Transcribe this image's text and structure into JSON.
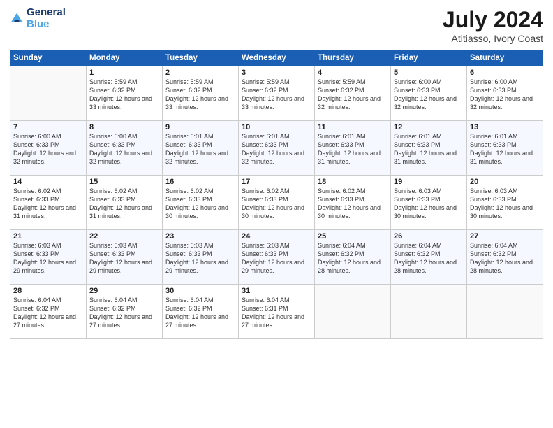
{
  "logo": {
    "line1": "General",
    "line2": "Blue"
  },
  "title": "July 2024",
  "location": "Atitiasso, Ivory Coast",
  "days_of_week": [
    "Sunday",
    "Monday",
    "Tuesday",
    "Wednesday",
    "Thursday",
    "Friday",
    "Saturday"
  ],
  "weeks": [
    [
      {
        "day": "",
        "sunrise": "",
        "sunset": "",
        "daylight": ""
      },
      {
        "day": "1",
        "sunrise": "Sunrise: 5:59 AM",
        "sunset": "Sunset: 6:32 PM",
        "daylight": "Daylight: 12 hours and 33 minutes."
      },
      {
        "day": "2",
        "sunrise": "Sunrise: 5:59 AM",
        "sunset": "Sunset: 6:32 PM",
        "daylight": "Daylight: 12 hours and 33 minutes."
      },
      {
        "day": "3",
        "sunrise": "Sunrise: 5:59 AM",
        "sunset": "Sunset: 6:32 PM",
        "daylight": "Daylight: 12 hours and 33 minutes."
      },
      {
        "day": "4",
        "sunrise": "Sunrise: 5:59 AM",
        "sunset": "Sunset: 6:32 PM",
        "daylight": "Daylight: 12 hours and 32 minutes."
      },
      {
        "day": "5",
        "sunrise": "Sunrise: 6:00 AM",
        "sunset": "Sunset: 6:33 PM",
        "daylight": "Daylight: 12 hours and 32 minutes."
      },
      {
        "day": "6",
        "sunrise": "Sunrise: 6:00 AM",
        "sunset": "Sunset: 6:33 PM",
        "daylight": "Daylight: 12 hours and 32 minutes."
      }
    ],
    [
      {
        "day": "7",
        "sunrise": "Sunrise: 6:00 AM",
        "sunset": "Sunset: 6:33 PM",
        "daylight": "Daylight: 12 hours and 32 minutes."
      },
      {
        "day": "8",
        "sunrise": "Sunrise: 6:00 AM",
        "sunset": "Sunset: 6:33 PM",
        "daylight": "Daylight: 12 hours and 32 minutes."
      },
      {
        "day": "9",
        "sunrise": "Sunrise: 6:01 AM",
        "sunset": "Sunset: 6:33 PM",
        "daylight": "Daylight: 12 hours and 32 minutes."
      },
      {
        "day": "10",
        "sunrise": "Sunrise: 6:01 AM",
        "sunset": "Sunset: 6:33 PM",
        "daylight": "Daylight: 12 hours and 32 minutes."
      },
      {
        "day": "11",
        "sunrise": "Sunrise: 6:01 AM",
        "sunset": "Sunset: 6:33 PM",
        "daylight": "Daylight: 12 hours and 31 minutes."
      },
      {
        "day": "12",
        "sunrise": "Sunrise: 6:01 AM",
        "sunset": "Sunset: 6:33 PM",
        "daylight": "Daylight: 12 hours and 31 minutes."
      },
      {
        "day": "13",
        "sunrise": "Sunrise: 6:01 AM",
        "sunset": "Sunset: 6:33 PM",
        "daylight": "Daylight: 12 hours and 31 minutes."
      }
    ],
    [
      {
        "day": "14",
        "sunrise": "Sunrise: 6:02 AM",
        "sunset": "Sunset: 6:33 PM",
        "daylight": "Daylight: 12 hours and 31 minutes."
      },
      {
        "day": "15",
        "sunrise": "Sunrise: 6:02 AM",
        "sunset": "Sunset: 6:33 PM",
        "daylight": "Daylight: 12 hours and 31 minutes."
      },
      {
        "day": "16",
        "sunrise": "Sunrise: 6:02 AM",
        "sunset": "Sunset: 6:33 PM",
        "daylight": "Daylight: 12 hours and 30 minutes."
      },
      {
        "day": "17",
        "sunrise": "Sunrise: 6:02 AM",
        "sunset": "Sunset: 6:33 PM",
        "daylight": "Daylight: 12 hours and 30 minutes."
      },
      {
        "day": "18",
        "sunrise": "Sunrise: 6:02 AM",
        "sunset": "Sunset: 6:33 PM",
        "daylight": "Daylight: 12 hours and 30 minutes."
      },
      {
        "day": "19",
        "sunrise": "Sunrise: 6:03 AM",
        "sunset": "Sunset: 6:33 PM",
        "daylight": "Daylight: 12 hours and 30 minutes."
      },
      {
        "day": "20",
        "sunrise": "Sunrise: 6:03 AM",
        "sunset": "Sunset: 6:33 PM",
        "daylight": "Daylight: 12 hours and 30 minutes."
      }
    ],
    [
      {
        "day": "21",
        "sunrise": "Sunrise: 6:03 AM",
        "sunset": "Sunset: 6:33 PM",
        "daylight": "Daylight: 12 hours and 29 minutes."
      },
      {
        "day": "22",
        "sunrise": "Sunrise: 6:03 AM",
        "sunset": "Sunset: 6:33 PM",
        "daylight": "Daylight: 12 hours and 29 minutes."
      },
      {
        "day": "23",
        "sunrise": "Sunrise: 6:03 AM",
        "sunset": "Sunset: 6:33 PM",
        "daylight": "Daylight: 12 hours and 29 minutes."
      },
      {
        "day": "24",
        "sunrise": "Sunrise: 6:03 AM",
        "sunset": "Sunset: 6:33 PM",
        "daylight": "Daylight: 12 hours and 29 minutes."
      },
      {
        "day": "25",
        "sunrise": "Sunrise: 6:04 AM",
        "sunset": "Sunset: 6:32 PM",
        "daylight": "Daylight: 12 hours and 28 minutes."
      },
      {
        "day": "26",
        "sunrise": "Sunrise: 6:04 AM",
        "sunset": "Sunset: 6:32 PM",
        "daylight": "Daylight: 12 hours and 28 minutes."
      },
      {
        "day": "27",
        "sunrise": "Sunrise: 6:04 AM",
        "sunset": "Sunset: 6:32 PM",
        "daylight": "Daylight: 12 hours and 28 minutes."
      }
    ],
    [
      {
        "day": "28",
        "sunrise": "Sunrise: 6:04 AM",
        "sunset": "Sunset: 6:32 PM",
        "daylight": "Daylight: 12 hours and 27 minutes."
      },
      {
        "day": "29",
        "sunrise": "Sunrise: 6:04 AM",
        "sunset": "Sunset: 6:32 PM",
        "daylight": "Daylight: 12 hours and 27 minutes."
      },
      {
        "day": "30",
        "sunrise": "Sunrise: 6:04 AM",
        "sunset": "Sunset: 6:32 PM",
        "daylight": "Daylight: 12 hours and 27 minutes."
      },
      {
        "day": "31",
        "sunrise": "Sunrise: 6:04 AM",
        "sunset": "Sunset: 6:31 PM",
        "daylight": "Daylight: 12 hours and 27 minutes."
      },
      {
        "day": "",
        "sunrise": "",
        "sunset": "",
        "daylight": ""
      },
      {
        "day": "",
        "sunrise": "",
        "sunset": "",
        "daylight": ""
      },
      {
        "day": "",
        "sunrise": "",
        "sunset": "",
        "daylight": ""
      }
    ]
  ]
}
